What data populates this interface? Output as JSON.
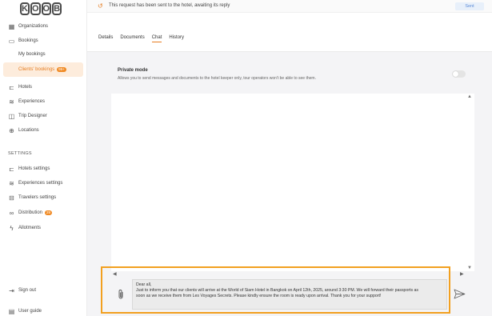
{
  "logo": [
    "K",
    "O",
    "O",
    "B"
  ],
  "sidebar": {
    "items": [
      {
        "label": "Organizations",
        "icon": "building-icon"
      },
      {
        "label": "Bookings",
        "icon": "bookings-icon"
      },
      {
        "label": "My bookings",
        "icon": ""
      },
      {
        "label": "Clients' bookings",
        "icon": "",
        "badge": "99+"
      },
      {
        "label": "Hotels",
        "icon": "bed-icon"
      },
      {
        "label": "Experiences",
        "icon": "layers-icon"
      },
      {
        "label": "Trip Designer",
        "icon": "map-icon"
      },
      {
        "label": "Locations",
        "icon": "globe-icon"
      }
    ],
    "settings_title": "SETTINGS",
    "settings_items": [
      {
        "label": "Hotels settings",
        "icon": "bed-icon"
      },
      {
        "label": "Experiences settings",
        "icon": "layers-icon"
      },
      {
        "label": "Travelers settings",
        "icon": "suitcase-icon"
      },
      {
        "label": "Distribution",
        "icon": "link-icon",
        "badge": "29"
      },
      {
        "label": "Allotments",
        "icon": "bolt-icon"
      }
    ],
    "signout": "Sign out",
    "userguide": "User guide"
  },
  "topbar": {
    "message": "This request has been sent to the hotel, awaiting its reply",
    "status_button": "Sent"
  },
  "tabs": [
    "Details",
    "Documents",
    "Chat",
    "History"
  ],
  "private_mode": {
    "title": "Private mode",
    "description": "Allows you to send messages and documents to the hotel keeper only, tour operators won't be able to see them."
  },
  "composer": {
    "line1": "Dear all,",
    "line2": "Just to inform you that our clients will arrive at the World of Siam Hotel in Bangkok on April 12th, 2025, around 3:30 PM. We will forward their passports as",
    "line3": "soon as we receive them from Les Voyages Secrets. Please kindly ensure the room is ready upon arrival. Thank you for your support!"
  },
  "colors": {
    "accent": "#e67e22",
    "highlight": "#f2a020"
  }
}
